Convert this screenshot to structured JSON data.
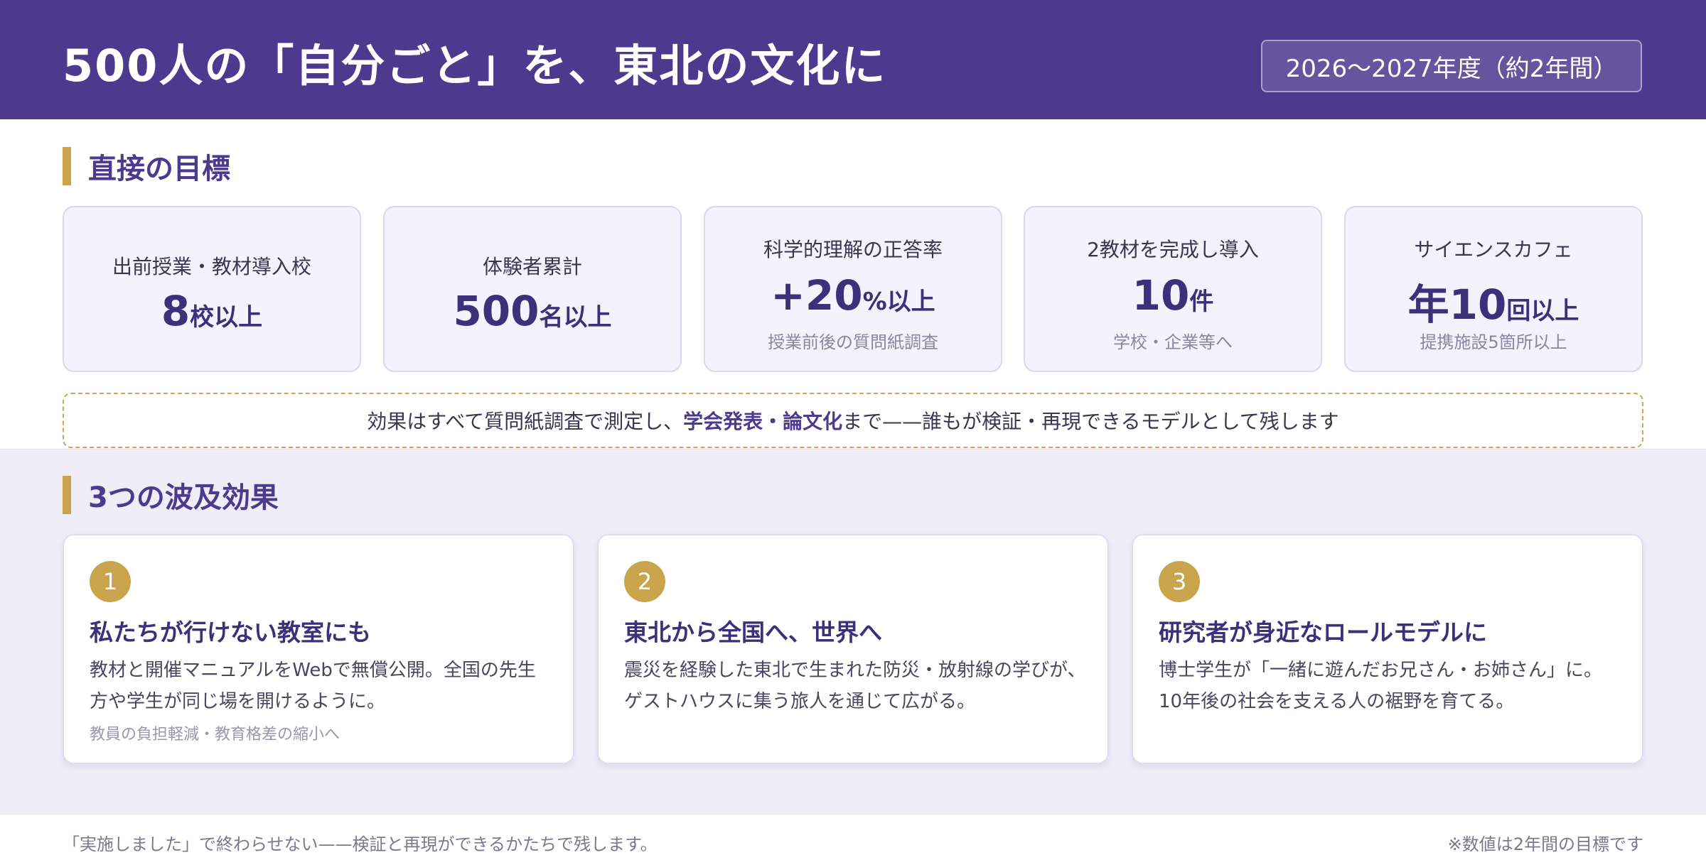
{
  "header": {
    "title": "500人の「自分ごと」を、東北の文化に",
    "period": "2026〜2027年度（約2年間）"
  },
  "section_direct": {
    "title": "直接の目標"
  },
  "stats": [
    {
      "label": "出前授業・教材導入校",
      "num": "8",
      "unit": "校以上",
      "note": ""
    },
    {
      "label": "体験者累計",
      "num": "500",
      "unit": "名以上",
      "note": ""
    },
    {
      "label": "科学的理解の正答率",
      "num": "+20",
      "unit": "%以上",
      "note": "授業前後の質問紙調査"
    },
    {
      "label": "2教材を完成し導入",
      "num": "10",
      "unit": "件",
      "note": "学校・企業等へ"
    },
    {
      "label": "サイエンスカフェ",
      "num": "年10",
      "unit": "回以上",
      "note": "提携施設5箇所以上"
    }
  ],
  "note": {
    "before": "効果はすべて質問紙調査で測定し、",
    "emphasis": "学会発表・論文化",
    "after": "まで——誰もが検証・再現できるモデルとして残します"
  },
  "section_effects": {
    "title": "3つの波及効果"
  },
  "effects": [
    {
      "number": "1",
      "title": "私たちが行けない教室にも",
      "body": "教材と開催マニュアルをWebで無償公開。全国の先生方や学生が同じ場を開けるように。",
      "sub": "教員の負担軽減・教育格差の縮小へ"
    },
    {
      "number": "2",
      "title": "東北から全国へ、世界へ",
      "body": "震災を経験した東北で生まれた防災・放射線の学びが、ゲストハウスに集う旅人を通じて広がる。",
      "sub": ""
    },
    {
      "number": "3",
      "title": "研究者が身近なロールモデルに",
      "body": "博士学生が「一緒に遊んだお兄さん・お姉さん」に。10年後の社会を支える人の裾野を育てる。",
      "sub": ""
    }
  ],
  "footer": {
    "left": "「実施しました」で終わらせない——検証と再現ができるかたちで残します。",
    "right": "※数値は2年間の目標です"
  },
  "colors": {
    "brand_purple": "#4c3a8e",
    "accent_gold": "#c9a44c",
    "card_bg": "#f4f2fc",
    "dashed_border": "#d6a15a"
  }
}
